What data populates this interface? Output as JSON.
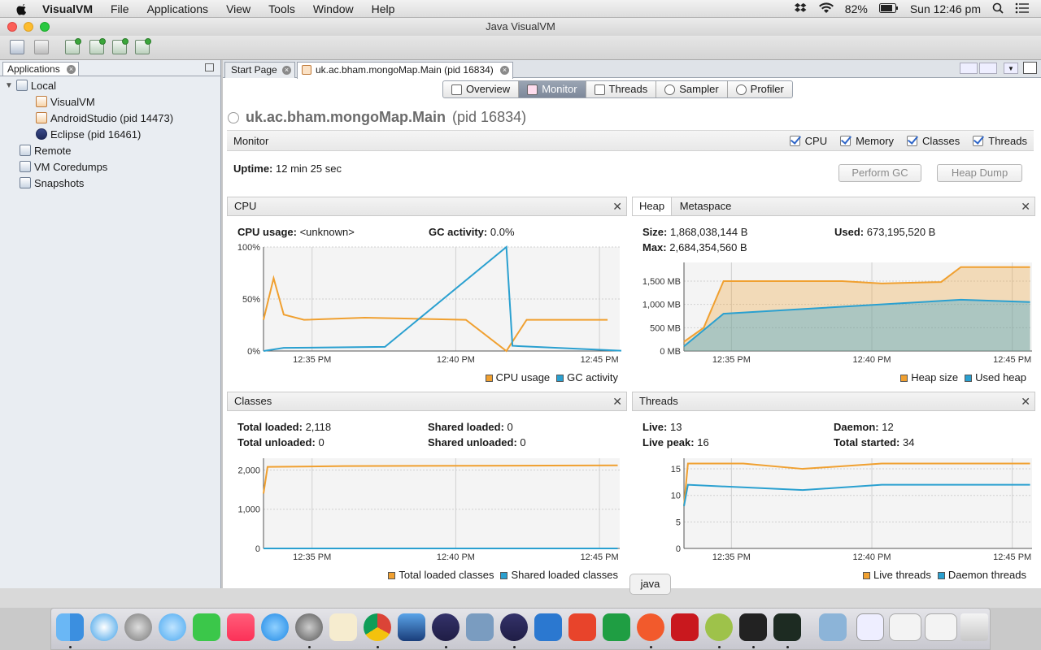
{
  "menubar": {
    "app": "VisualVM",
    "items": [
      "File",
      "Applications",
      "View",
      "Tools",
      "Window",
      "Help"
    ],
    "battery": "82%",
    "clock": "Sun 12:46 pm"
  },
  "window": {
    "title": "Java VisualVM"
  },
  "left_panel": {
    "tab_label": "Applications",
    "local_label": "Local",
    "local_items": [
      "VisualVM",
      "AndroidStudio (pid 14473)",
      "Eclipse (pid 16461)"
    ],
    "other_items": [
      "Remote",
      "VM Coredumps",
      "Snapshots"
    ]
  },
  "doc_tabs": [
    "Start Page",
    "uk.ac.bham.mongoMap.Main (pid 16834)"
  ],
  "sub_tabs": [
    "Overview",
    "Monitor",
    "Threads",
    "Sampler",
    "Profiler"
  ],
  "app_title": {
    "name": "uk.ac.bham.mongoMap.Main",
    "pid": "(pid 16834)"
  },
  "monitor": {
    "label": "Monitor",
    "checkboxes": [
      "CPU",
      "Memory",
      "Classes",
      "Threads"
    ],
    "uptime_label": "Uptime:",
    "uptime_value": "12 min 25 sec",
    "perform_gc": "Perform GC",
    "heap_dump": "Heap Dump"
  },
  "cpu_panel": {
    "title": "CPU",
    "usage_label": "CPU usage:",
    "usage_value": "<unknown>",
    "gc_label": "GC activity:",
    "gc_value": "0.0%",
    "legend": [
      "CPU usage",
      "GC activity"
    ]
  },
  "heap_panel": {
    "tabs": [
      "Heap",
      "Metaspace"
    ],
    "size_label": "Size:",
    "size_value": "1,868,038,144 B",
    "used_label": "Used:",
    "used_value": "673,195,520 B",
    "max_label": "Max:",
    "max_value": "2,684,354,560 B",
    "legend": [
      "Heap size",
      "Used heap"
    ]
  },
  "classes_panel": {
    "title": "Classes",
    "total_loaded_label": "Total loaded:",
    "total_loaded_value": "2,118",
    "total_unloaded_label": "Total unloaded:",
    "total_unloaded_value": "0",
    "shared_loaded_label": "Shared loaded:",
    "shared_loaded_value": "0",
    "shared_unloaded_label": "Shared unloaded:",
    "shared_unloaded_value": "0",
    "legend": [
      "Total loaded classes",
      "Shared loaded classes"
    ]
  },
  "threads_panel": {
    "title": "Threads",
    "live_label": "Live:",
    "live_value": "13",
    "peak_label": "Live peak:",
    "peak_value": "16",
    "daemon_label": "Daemon:",
    "daemon_value": "12",
    "started_label": "Total started:",
    "started_value": "34",
    "legend": [
      "Live threads",
      "Daemon threads"
    ]
  },
  "tooltip": "java",
  "colors": {
    "orange": "#f0a030",
    "blue": "#2aa0d0"
  },
  "chart_data": [
    {
      "type": "line",
      "title": "CPU",
      "x_ticks": [
        "12:35 PM",
        "12:40 PM",
        "12:45 PM"
      ],
      "y_ticks": [
        "0%",
        "50%",
        "100%"
      ],
      "ylim": [
        0,
        100
      ],
      "series": [
        {
          "name": "CPU usage",
          "points": [
            [
              0,
              30
            ],
            [
              0.5,
              70
            ],
            [
              1,
              35
            ],
            [
              2,
              30
            ],
            [
              5,
              32
            ],
            [
              10,
              30
            ],
            [
              12,
              0
            ],
            [
              13,
              30
            ],
            [
              16,
              30
            ],
            [
              17,
              30
            ]
          ]
        },
        {
          "name": "GC activity",
          "points": [
            [
              0,
              0
            ],
            [
              1,
              3
            ],
            [
              6,
              4
            ],
            [
              12,
              100
            ],
            [
              12.3,
              5
            ],
            [
              18,
              0
            ]
          ]
        }
      ]
    },
    {
      "type": "area",
      "title": "Heap",
      "x_ticks": [
        "12:35 PM",
        "12:40 PM",
        "12:45 PM"
      ],
      "y_ticks": [
        "0 MB",
        "500 MB",
        "1,000 MB",
        "1,500 MB"
      ],
      "ylim": [
        0,
        1900
      ],
      "series": [
        {
          "name": "Heap size",
          "points": [
            [
              0,
              200
            ],
            [
              1,
              500
            ],
            [
              1.5,
              1000
            ],
            [
              2,
              1500
            ],
            [
              8,
              1500
            ],
            [
              10,
              1450
            ],
            [
              13,
              1480
            ],
            [
              14,
              1800
            ],
            [
              17.5,
              1800
            ]
          ]
        },
        {
          "name": "Used heap",
          "points": [
            [
              0,
              100
            ],
            [
              2,
              800
            ],
            [
              6,
              900
            ],
            [
              10,
              1000
            ],
            [
              14,
              1100
            ],
            [
              17.5,
              1050
            ]
          ]
        }
      ]
    },
    {
      "type": "line",
      "title": "Classes",
      "x_ticks": [
        "12:35 PM",
        "12:40 PM",
        "12:45 PM"
      ],
      "y_ticks": [
        "0",
        "1,000",
        "2,000"
      ],
      "ylim": [
        0,
        2300
      ],
      "series": [
        {
          "name": "Total loaded classes",
          "points": [
            [
              0,
              1400
            ],
            [
              0.2,
              2080
            ],
            [
              4,
              2100
            ],
            [
              17.5,
              2118
            ]
          ]
        },
        {
          "name": "Shared loaded classes",
          "points": [
            [
              0,
              0
            ],
            [
              17.5,
              0
            ]
          ]
        }
      ]
    },
    {
      "type": "line",
      "title": "Threads",
      "x_ticks": [
        "12:35 PM",
        "12:40 PM",
        "12:45 PM"
      ],
      "y_ticks": [
        "0",
        "5",
        "10",
        "15"
      ],
      "ylim": [
        0,
        17
      ],
      "series": [
        {
          "name": "Live threads",
          "points": [
            [
              0,
              8
            ],
            [
              0.2,
              16
            ],
            [
              3,
              16
            ],
            [
              6,
              15
            ],
            [
              10,
              16
            ],
            [
              15,
              16
            ],
            [
              17.5,
              16
            ]
          ]
        },
        {
          "name": "Daemon threads",
          "points": [
            [
              0,
              8
            ],
            [
              0.2,
              12
            ],
            [
              6,
              11
            ],
            [
              10,
              12
            ],
            [
              17.5,
              12
            ]
          ]
        }
      ]
    }
  ]
}
